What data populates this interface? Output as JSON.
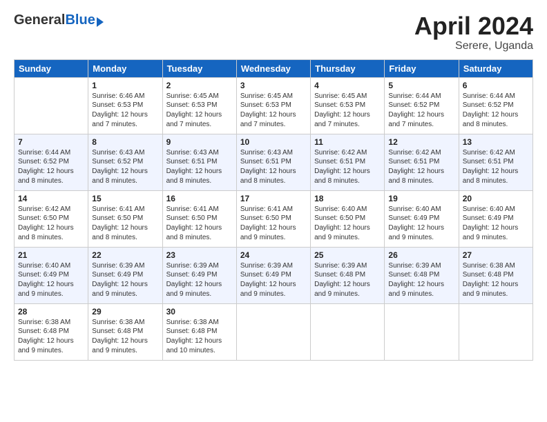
{
  "header": {
    "logo_general": "General",
    "logo_blue": "Blue",
    "month": "April 2024",
    "location": "Serere, Uganda"
  },
  "columns": [
    "Sunday",
    "Monday",
    "Tuesday",
    "Wednesday",
    "Thursday",
    "Friday",
    "Saturday"
  ],
  "weeks": [
    [
      {
        "day": "",
        "info": ""
      },
      {
        "day": "1",
        "info": "Sunrise: 6:46 AM\nSunset: 6:53 PM\nDaylight: 12 hours\nand 7 minutes."
      },
      {
        "day": "2",
        "info": "Sunrise: 6:45 AM\nSunset: 6:53 PM\nDaylight: 12 hours\nand 7 minutes."
      },
      {
        "day": "3",
        "info": "Sunrise: 6:45 AM\nSunset: 6:53 PM\nDaylight: 12 hours\nand 7 minutes."
      },
      {
        "day": "4",
        "info": "Sunrise: 6:45 AM\nSunset: 6:53 PM\nDaylight: 12 hours\nand 7 minutes."
      },
      {
        "day": "5",
        "info": "Sunrise: 6:44 AM\nSunset: 6:52 PM\nDaylight: 12 hours\nand 7 minutes."
      },
      {
        "day": "6",
        "info": "Sunrise: 6:44 AM\nSunset: 6:52 PM\nDaylight: 12 hours\nand 8 minutes."
      }
    ],
    [
      {
        "day": "7",
        "info": "Sunrise: 6:44 AM\nSunset: 6:52 PM\nDaylight: 12 hours\nand 8 minutes."
      },
      {
        "day": "8",
        "info": "Sunrise: 6:43 AM\nSunset: 6:52 PM\nDaylight: 12 hours\nand 8 minutes."
      },
      {
        "day": "9",
        "info": "Sunrise: 6:43 AM\nSunset: 6:51 PM\nDaylight: 12 hours\nand 8 minutes."
      },
      {
        "day": "10",
        "info": "Sunrise: 6:43 AM\nSunset: 6:51 PM\nDaylight: 12 hours\nand 8 minutes."
      },
      {
        "day": "11",
        "info": "Sunrise: 6:42 AM\nSunset: 6:51 PM\nDaylight: 12 hours\nand 8 minutes."
      },
      {
        "day": "12",
        "info": "Sunrise: 6:42 AM\nSunset: 6:51 PM\nDaylight: 12 hours\nand 8 minutes."
      },
      {
        "day": "13",
        "info": "Sunrise: 6:42 AM\nSunset: 6:51 PM\nDaylight: 12 hours\nand 8 minutes."
      }
    ],
    [
      {
        "day": "14",
        "info": "Sunrise: 6:42 AM\nSunset: 6:50 PM\nDaylight: 12 hours\nand 8 minutes."
      },
      {
        "day": "15",
        "info": "Sunrise: 6:41 AM\nSunset: 6:50 PM\nDaylight: 12 hours\nand 8 minutes."
      },
      {
        "day": "16",
        "info": "Sunrise: 6:41 AM\nSunset: 6:50 PM\nDaylight: 12 hours\nand 8 minutes."
      },
      {
        "day": "17",
        "info": "Sunrise: 6:41 AM\nSunset: 6:50 PM\nDaylight: 12 hours\nand 9 minutes."
      },
      {
        "day": "18",
        "info": "Sunrise: 6:40 AM\nSunset: 6:50 PM\nDaylight: 12 hours\nand 9 minutes."
      },
      {
        "day": "19",
        "info": "Sunrise: 6:40 AM\nSunset: 6:49 PM\nDaylight: 12 hours\nand 9 minutes."
      },
      {
        "day": "20",
        "info": "Sunrise: 6:40 AM\nSunset: 6:49 PM\nDaylight: 12 hours\nand 9 minutes."
      }
    ],
    [
      {
        "day": "21",
        "info": "Sunrise: 6:40 AM\nSunset: 6:49 PM\nDaylight: 12 hours\nand 9 minutes."
      },
      {
        "day": "22",
        "info": "Sunrise: 6:39 AM\nSunset: 6:49 PM\nDaylight: 12 hours\nand 9 minutes."
      },
      {
        "day": "23",
        "info": "Sunrise: 6:39 AM\nSunset: 6:49 PM\nDaylight: 12 hours\nand 9 minutes."
      },
      {
        "day": "24",
        "info": "Sunrise: 6:39 AM\nSunset: 6:49 PM\nDaylight: 12 hours\nand 9 minutes."
      },
      {
        "day": "25",
        "info": "Sunrise: 6:39 AM\nSunset: 6:48 PM\nDaylight: 12 hours\nand 9 minutes."
      },
      {
        "day": "26",
        "info": "Sunrise: 6:39 AM\nSunset: 6:48 PM\nDaylight: 12 hours\nand 9 minutes."
      },
      {
        "day": "27",
        "info": "Sunrise: 6:38 AM\nSunset: 6:48 PM\nDaylight: 12 hours\nand 9 minutes."
      }
    ],
    [
      {
        "day": "28",
        "info": "Sunrise: 6:38 AM\nSunset: 6:48 PM\nDaylight: 12 hours\nand 9 minutes."
      },
      {
        "day": "29",
        "info": "Sunrise: 6:38 AM\nSunset: 6:48 PM\nDaylight: 12 hours\nand 9 minutes."
      },
      {
        "day": "30",
        "info": "Sunrise: 6:38 AM\nSunset: 6:48 PM\nDaylight: 12 hours\nand 10 minutes."
      },
      {
        "day": "",
        "info": ""
      },
      {
        "day": "",
        "info": ""
      },
      {
        "day": "",
        "info": ""
      },
      {
        "day": "",
        "info": ""
      }
    ]
  ]
}
